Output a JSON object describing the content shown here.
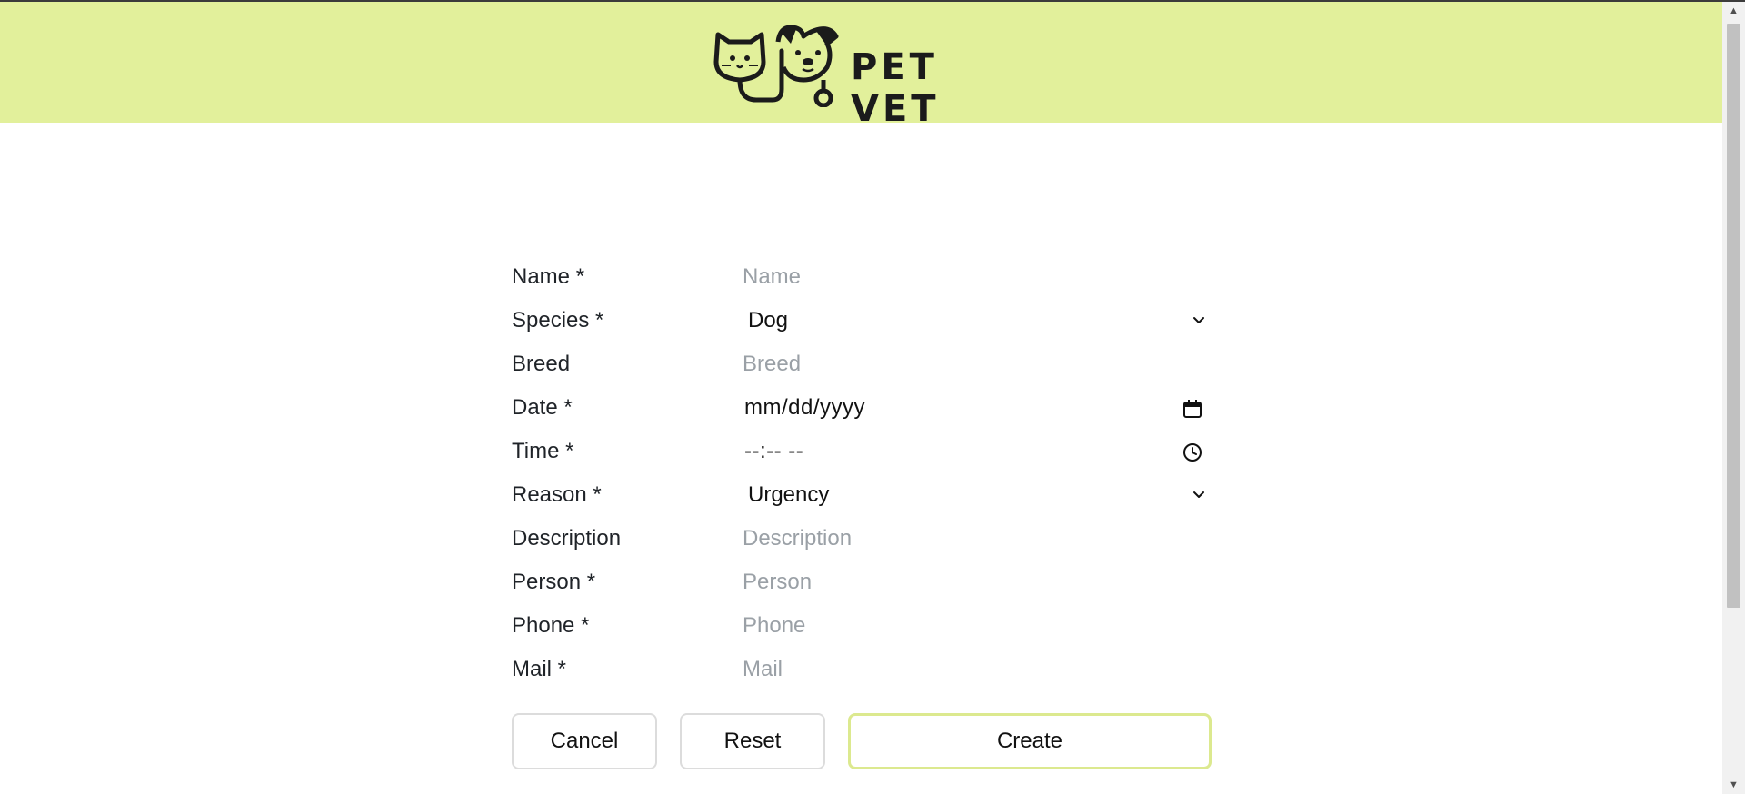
{
  "header": {
    "brand": "PET VET",
    "background": "#e2f09b"
  },
  "form": {
    "name": {
      "label": "Name *",
      "placeholder": "Name"
    },
    "species": {
      "label": "Species *",
      "value": "Dog"
    },
    "breed": {
      "label": "Breed",
      "placeholder": "Breed"
    },
    "date": {
      "label": "Date *",
      "value": "mm/dd/yyyy"
    },
    "time": {
      "label": "Time *",
      "value": "--:-- --"
    },
    "reason": {
      "label": "Reason *",
      "value": "Urgency"
    },
    "description": {
      "label": "Description",
      "placeholder": "Description"
    },
    "person": {
      "label": "Person *",
      "placeholder": "Person"
    },
    "phone": {
      "label": "Phone *",
      "placeholder": "Phone"
    },
    "mail": {
      "label": "Mail *",
      "placeholder": "Mail"
    }
  },
  "actions": {
    "cancel": "Cancel",
    "reset": "Reset",
    "create": "Create",
    "create_border": "#dce98f"
  },
  "icons": {
    "logo": "pet-vet-logo-icon",
    "select": "chevron-down-icon",
    "date": "calendar-icon",
    "time": "clock-icon"
  }
}
